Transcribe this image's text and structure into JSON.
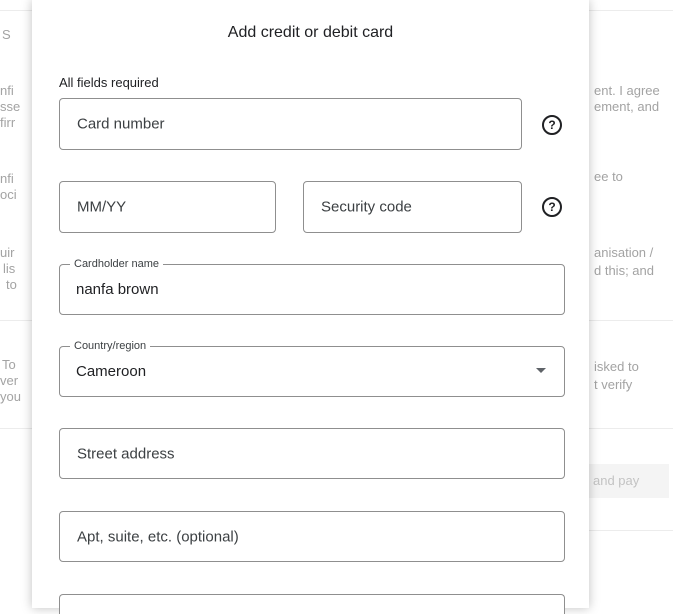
{
  "background": {
    "left_fragments": [
      "S",
      "nfi",
      "sse",
      "firr",
      "nfi",
      "oci",
      "uir",
      "lis",
      "to",
      "To",
      "ver",
      "you"
    ],
    "right_fragments": [
      "ent. I agree",
      "ement, and",
      "ee to",
      "anisation /",
      "d this; and",
      "isked to",
      "t verify"
    ],
    "pay_button_label": "and pay"
  },
  "dialog": {
    "title": "Add credit or debit card",
    "required_note": "All fields required",
    "fields": {
      "card_number": {
        "placeholder": "Card number"
      },
      "expiry": {
        "placeholder": "MM/YY"
      },
      "security_code": {
        "placeholder": "Security code"
      },
      "cardholder_name": {
        "label": "Cardholder name",
        "value": "nanfa brown"
      },
      "country_region": {
        "label": "Country/region",
        "value": "Cameroon"
      },
      "street_address": {
        "placeholder": "Street address"
      },
      "apt_suite": {
        "placeholder": "Apt, suite, etc. (optional)"
      }
    },
    "help_icon_glyph": "?"
  }
}
